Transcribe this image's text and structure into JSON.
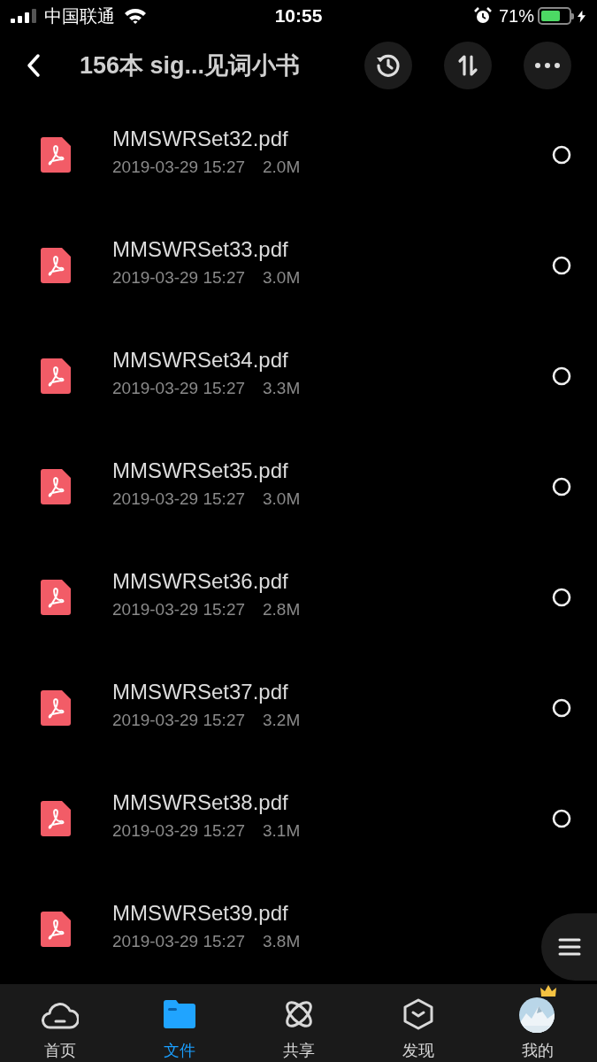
{
  "status_bar": {
    "carrier": "中国联通",
    "time": "10:55",
    "battery_percent": "71%",
    "battery": {
      "level": 0.71,
      "charging": true
    }
  },
  "header": {
    "title": "156本 sig...见词小书"
  },
  "files": [
    {
      "name": "MMSWRSet32.pdf",
      "date": "2019-03-29 15:27",
      "size": "2.0M",
      "selected": false
    },
    {
      "name": "MMSWRSet33.pdf",
      "date": "2019-03-29 15:27",
      "size": "3.0M",
      "selected": false
    },
    {
      "name": "MMSWRSet34.pdf",
      "date": "2019-03-29 15:27",
      "size": "3.3M",
      "selected": false
    },
    {
      "name": "MMSWRSet35.pdf",
      "date": "2019-03-29 15:27",
      "size": "3.0M",
      "selected": false
    },
    {
      "name": "MMSWRSet36.pdf",
      "date": "2019-03-29 15:27",
      "size": "2.8M",
      "selected": false
    },
    {
      "name": "MMSWRSet37.pdf",
      "date": "2019-03-29 15:27",
      "size": "3.2M",
      "selected": false
    },
    {
      "name": "MMSWRSet38.pdf",
      "date": "2019-03-29 15:27",
      "size": "3.1M",
      "selected": false
    },
    {
      "name": "MMSWRSet39.pdf",
      "date": "2019-03-29 15:27",
      "size": "3.8M"
    }
  ],
  "tab_bar": [
    {
      "kind": "cloud",
      "label": "首页",
      "selected": false
    },
    {
      "kind": "folder",
      "label": "文件",
      "selected": true
    },
    {
      "kind": "orbit",
      "label": "共享",
      "selected": false
    },
    {
      "kind": "cube",
      "label": "发现",
      "selected": false
    },
    {
      "kind": "avatar",
      "label": "我的",
      "selected": false
    }
  ]
}
